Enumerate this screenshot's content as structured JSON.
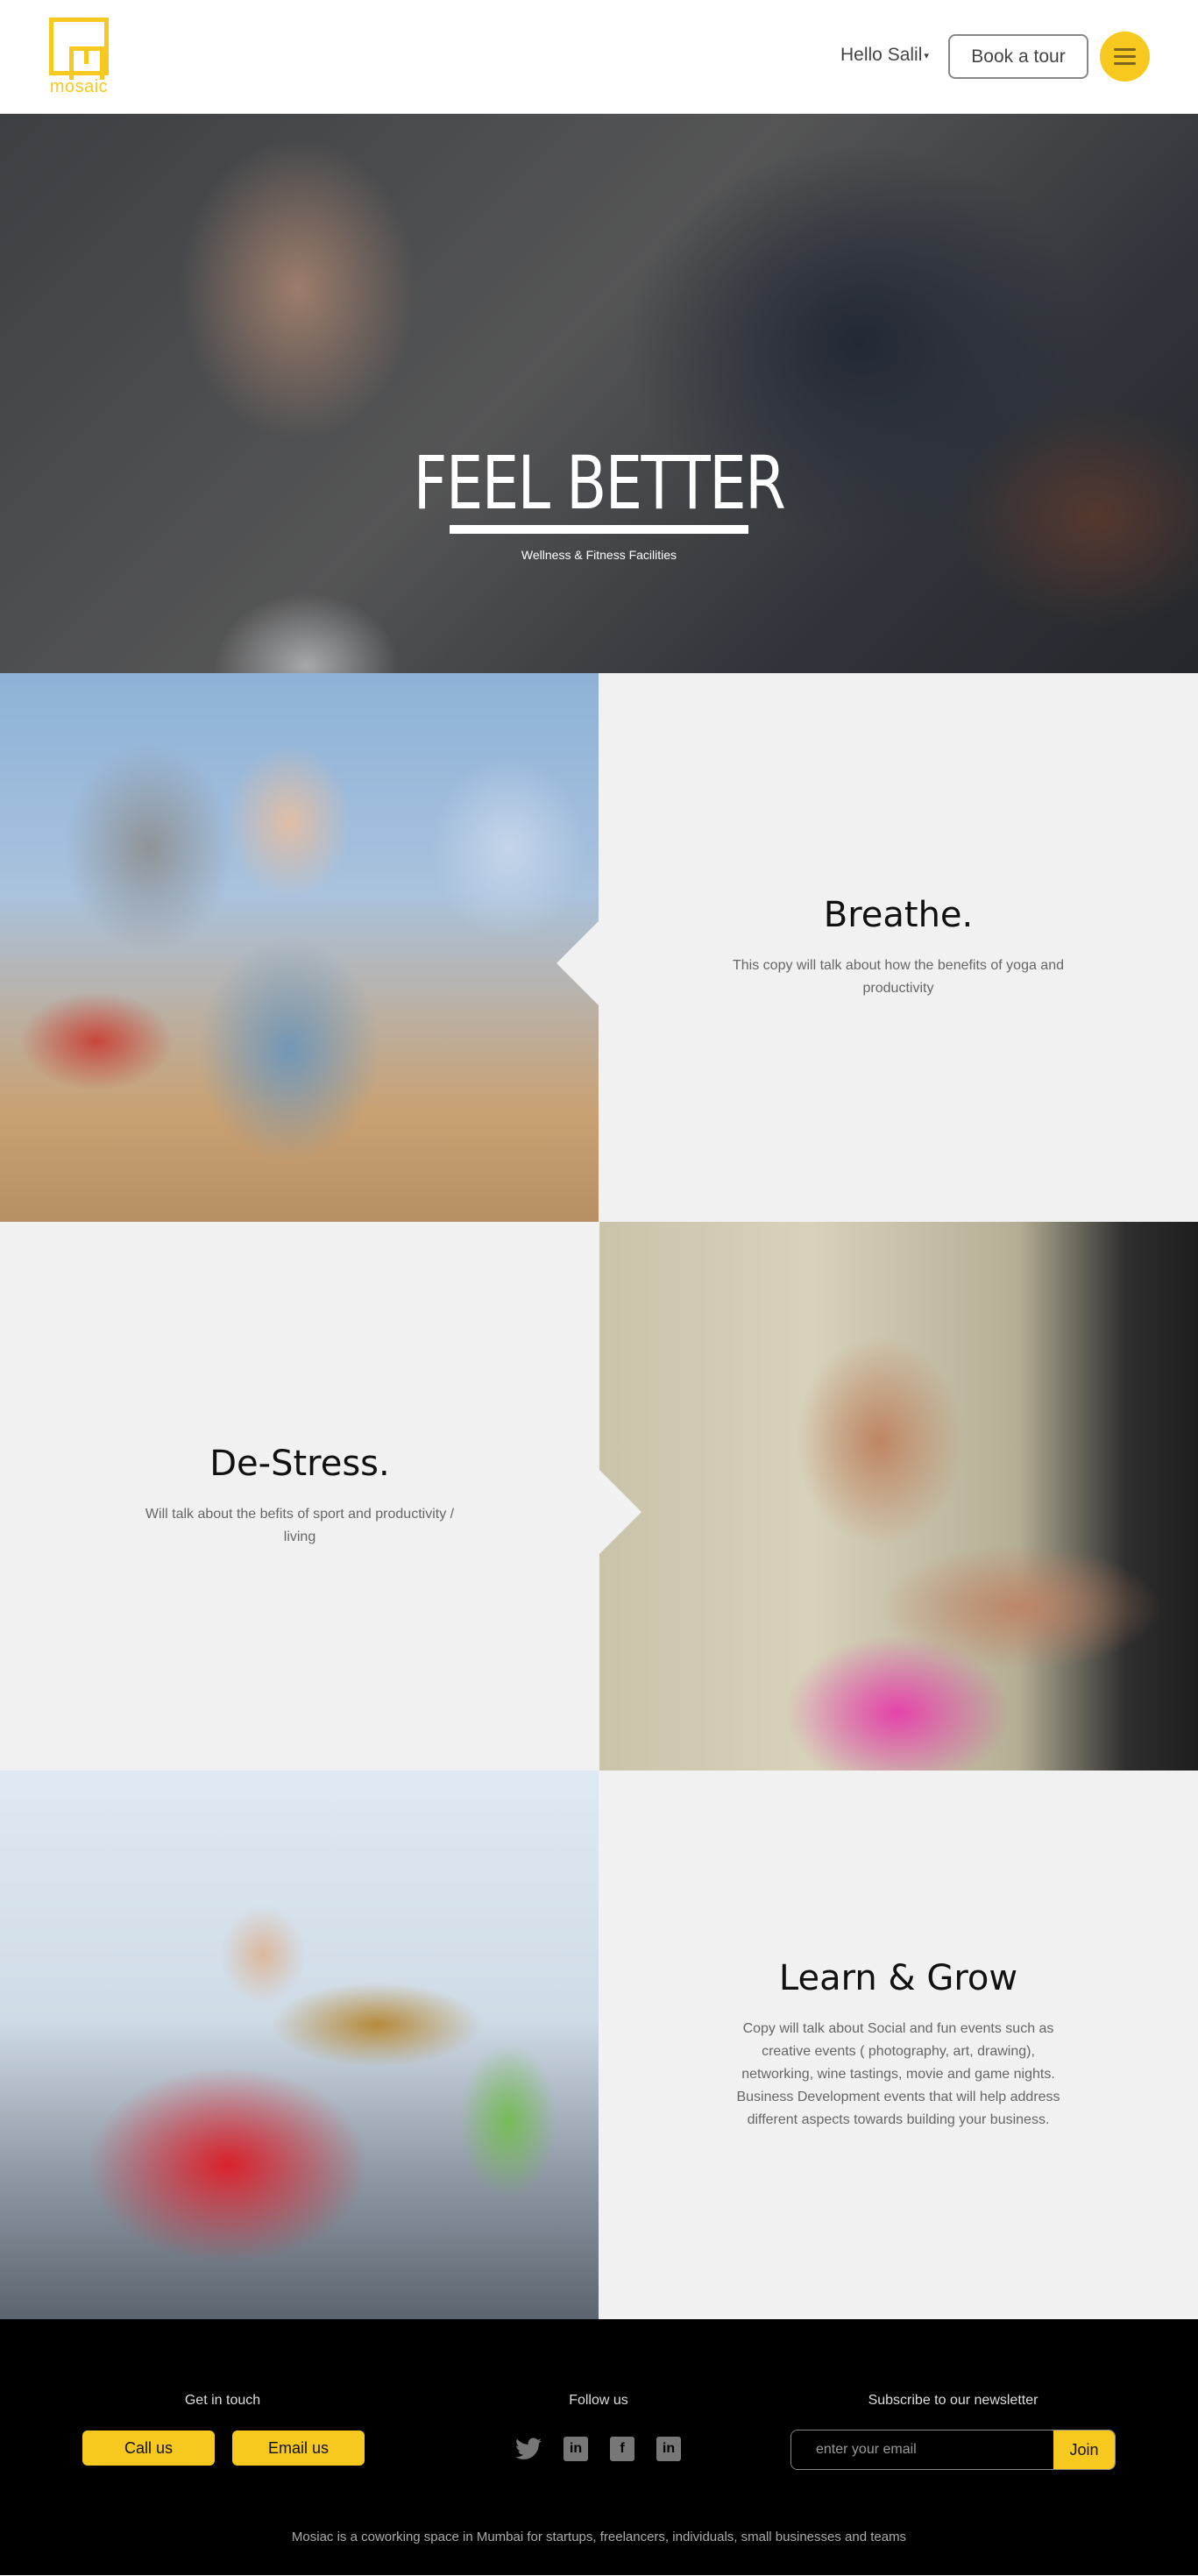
{
  "header": {
    "logo_text": "mosaic",
    "greeting": "Hello Salil",
    "caret": "▾",
    "tour_label": "Book a tour"
  },
  "hero": {
    "title": "FEEL BETTER",
    "subtitle": "Wellness & Fitness Facilities"
  },
  "features": [
    {
      "title": "Breathe.",
      "body": "This copy will talk about how the benefits of yoga and productivity"
    },
    {
      "title": "De-Stress.",
      "body": "Will talk about the befits of sport and productivity / living"
    },
    {
      "title": "Learn & Grow",
      "body": "Copy will talk about Social and fun events such as creative events ( photography, art, drawing), networking, wine tastings, movie and game nights. Business Development events that will help address different aspects towards building your business."
    }
  ],
  "footer": {
    "contact_title": "Get in touch",
    "call_label": "Call us",
    "email_label": "Email us",
    "follow_title": "Follow us",
    "social": [
      "twitter-icon",
      "linkedin-icon",
      "facebook-icon",
      "linkedin-icon"
    ],
    "newsletter_title": "Subscribe to our newsletter",
    "newsletter_placeholder": "enter your email",
    "join_label": "Join",
    "tagline": "Mosiac is a coworking space in Mumbai for startups, freelancers, individuals, small businesses and teams"
  },
  "colors": {
    "accent": "#f7c81e",
    "panel_bg": "#f1f1f1",
    "footer_bg": "#000000"
  }
}
